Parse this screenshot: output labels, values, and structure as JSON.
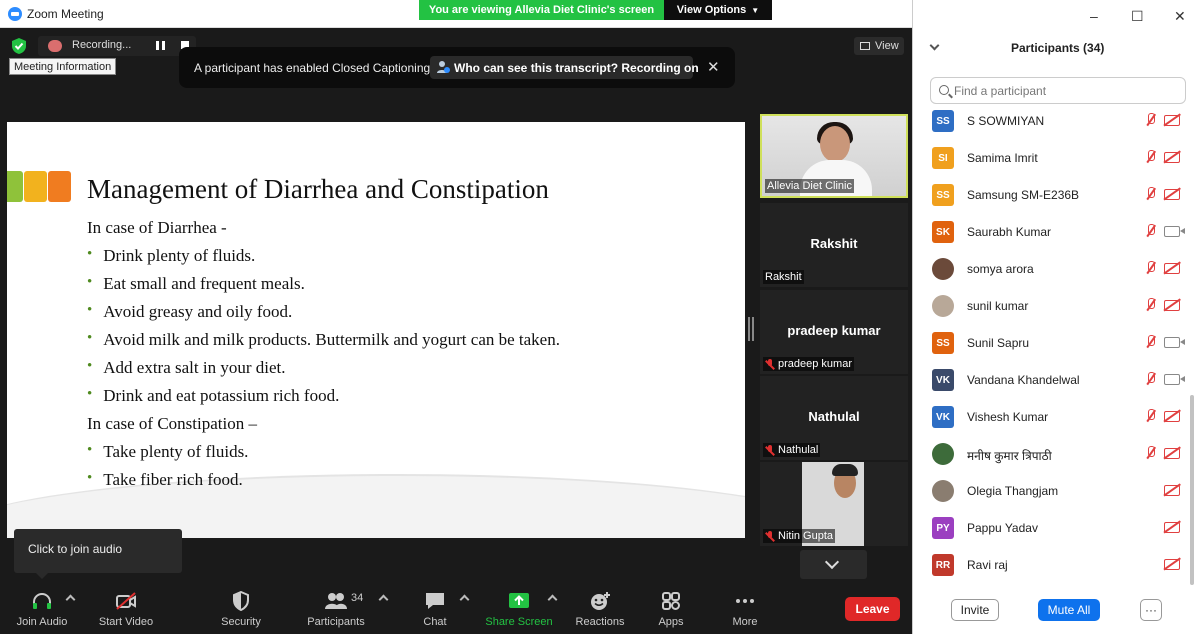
{
  "window": {
    "title": "Zoom Meeting",
    "minimize": "–",
    "maximize": "☐",
    "close": "✕"
  },
  "share_banner": {
    "message": "You are viewing Allevia Diet Clinic's screen",
    "options_label": "View Options"
  },
  "recording": {
    "label": "Recording..."
  },
  "meeting_info_tooltip": "Meeting Information",
  "cc_notice": {
    "message": "A participant has enabled Closed Captioning",
    "link": "Who can see this transcript? Recording on"
  },
  "view_button": "View",
  "slide": {
    "accent_colors": [
      "#8fc23a",
      "#f2b21e",
      "#f07c20"
    ],
    "title": "Management of Diarrhea and Constipation",
    "heading1": "In case of Diarrhea -",
    "bullets1": [
      "Drink plenty of fluids.",
      "Eat small and frequent meals.",
      "Avoid greasy and oily food.",
      "Avoid milk and milk products. Buttermilk and yogurt can be taken.",
      "Add extra salt in your diet.",
      "Drink and eat potassium rich food."
    ],
    "heading2": "In case of Constipation –",
    "bullets2": [
      "Take plenty of fluids.",
      "Take fiber rich food."
    ]
  },
  "gallery": [
    {
      "label": "Allevia Diet Clinic"
    },
    {
      "name": "Rakshit",
      "label": "Rakshit"
    },
    {
      "name": "pradeep kumar",
      "label": "pradeep kumar",
      "muted": true
    },
    {
      "name": "Nathulal",
      "label": "Nathulal",
      "muted": true
    },
    {
      "label": "Nitin Gupta",
      "muted": true
    }
  ],
  "audio_tooltip": "Click to join audio",
  "toolbar": {
    "join_audio": "Join Audio",
    "start_video": "Start Video",
    "security": "Security",
    "participants": "Participants",
    "participants_count": "34",
    "chat": "Chat",
    "share_screen": "Share Screen",
    "reactions": "Reactions",
    "apps": "Apps",
    "more": "More",
    "leave": "Leave"
  },
  "panel": {
    "title": "Participants (34)",
    "search_placeholder": "Find a participant",
    "participants": [
      {
        "initials": "SS",
        "name": "S SOWMIYAN",
        "color": "#2e6ec4",
        "video": "off"
      },
      {
        "initials": "SI",
        "name": "Samima Imrit",
        "color": "#f0a01e",
        "video": "off"
      },
      {
        "initials": "SS",
        "name": "Samsung SM-E236B",
        "color": "#f0a01e",
        "video": "off"
      },
      {
        "initials": "SK",
        "name": "Saurabh Kumar",
        "color": "#e0620e",
        "video": "on"
      },
      {
        "initials": "",
        "name": "somya arora",
        "color": "#6b4a3a",
        "video": "off",
        "photo": true
      },
      {
        "initials": "",
        "name": "sunil kumar",
        "color": "#b8a898",
        "video": "off",
        "photo": true
      },
      {
        "initials": "SS",
        "name": "Sunil Sapru",
        "color": "#e0620e",
        "video": "on"
      },
      {
        "initials": "VK",
        "name": "Vandana Khandelwal",
        "color": "#3a4a6a",
        "video": "on"
      },
      {
        "initials": "VK",
        "name": "Vishesh Kumar",
        "color": "#2e6ec4",
        "video": "off"
      },
      {
        "initials": "",
        "name": "मनीष कुमार त्रिपाठी",
        "color": "#3d6b3a",
        "video": "off",
        "photo": true
      },
      {
        "initials": "",
        "name": "Olegia Thangjam",
        "color": "#8a7d70",
        "video": "off",
        "photo": true,
        "nomic": true
      },
      {
        "initials": "PY",
        "name": "Pappu Yadav",
        "color": "#9b3fc0",
        "video": "off",
        "nomic": true
      },
      {
        "initials": "RR",
        "name": "Ravi raj",
        "color": "#c0392b",
        "video": "off",
        "nomic": true
      }
    ],
    "invite": "Invite",
    "mute_all": "Mute All",
    "more": "···"
  }
}
